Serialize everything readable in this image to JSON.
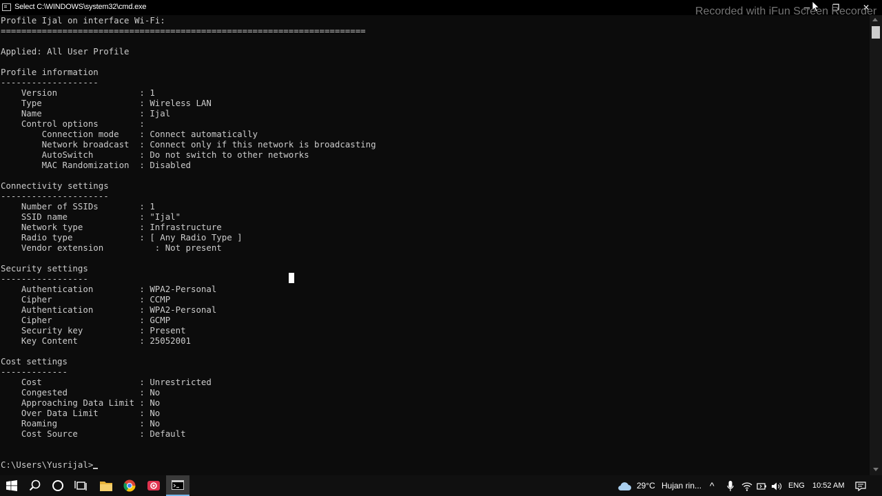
{
  "window": {
    "title": "Select C:\\WINDOWS\\system32\\cmd.exe",
    "controls": {
      "minimize": "─",
      "maximize": "❐",
      "close": "✕"
    }
  },
  "watermark": "Recorded with iFun Screen Recorder",
  "console": {
    "lines": [
      "Profile Ijal on interface Wi-Fi:",
      "=======================================================================",
      "",
      "Applied: All User Profile",
      "",
      "Profile information",
      "-------------------",
      "    Version                : 1",
      "    Type                   : Wireless LAN",
      "    Name                   : Ijal",
      "    Control options        :",
      "        Connection mode    : Connect automatically",
      "        Network broadcast  : Connect only if this network is broadcasting",
      "        AutoSwitch         : Do not switch to other networks",
      "        MAC Randomization  : Disabled",
      "",
      "Connectivity settings",
      "---------------------",
      "    Number of SSIDs        : 1",
      "    SSID name              : \"Ijal\"",
      "    Network type           : Infrastructure",
      "    Radio type             : [ Any Radio Type ]",
      "    Vendor extension          : Not present",
      "",
      "Security settings",
      "-----------------",
      "    Authentication         : WPA2-Personal",
      "    Cipher                 : CCMP",
      "    Authentication         : WPA2-Personal",
      "    Cipher                 : GCMP",
      "    Security key           : Present",
      "    Key Content            : 25052001",
      "",
      "Cost settings",
      "-------------",
      "    Cost                   : Unrestricted",
      "    Congested              : No",
      "    Approaching Data Limit : No",
      "    Over Data Limit        : No",
      "    Roaming                : No",
      "    Cost Source            : Default",
      "",
      ""
    ],
    "prompt": "C:\\Users\\Yusrijal>"
  },
  "taskbar": {
    "icons": [
      "windows-start-icon",
      "search-icon",
      "cortana-icon",
      "task-view-icon",
      "file-explorer-icon",
      "chrome-icon",
      "screen-recorder-icon",
      "cmd-icon"
    ],
    "weather_temp": "29°C",
    "weather_text": "Hujan rin...",
    "language": "ENG",
    "time": "10:52 AM",
    "accent_color": "#76b9ed"
  }
}
